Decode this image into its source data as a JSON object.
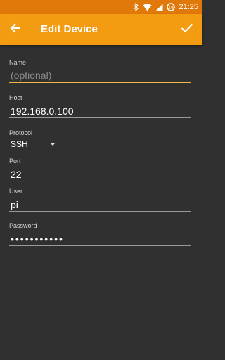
{
  "status_bar": {
    "time": "21:25"
  },
  "toolbar": {
    "title": "Edit Device"
  },
  "form": {
    "name": {
      "label": "Name",
      "value": "",
      "placeholder": "(optional)"
    },
    "host": {
      "label": "Host",
      "value": "192.168.0.100"
    },
    "protocol": {
      "label": "Protocol",
      "value": "SSH"
    },
    "port": {
      "label": "Port",
      "value": "22"
    },
    "user": {
      "label": "User",
      "value": "pi"
    },
    "password": {
      "label": "Password",
      "value": "•••••••••••"
    }
  },
  "colors": {
    "toolbar": "#f39c12",
    "status_bar": "#e0790a",
    "focus_accent": "#f0b845",
    "background": "#303030"
  }
}
